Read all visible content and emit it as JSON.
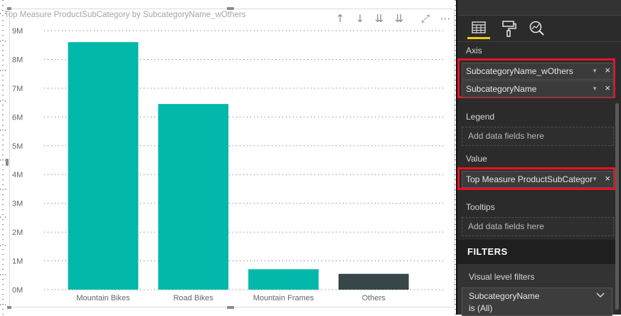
{
  "chart_data": {
    "type": "bar",
    "title": "Top Measure ProductSubCategory by SubcategoryName_wOthers",
    "categories": [
      "Mountain Bikes",
      "Road Bikes",
      "Mountain Frames",
      "Others"
    ],
    "values": [
      8600000,
      6450000,
      710000,
      550000
    ],
    "bar_colors": [
      "#01b8aa",
      "#01b8aa",
      "#01b8aa",
      "#374649"
    ],
    "yticks": [
      "0M",
      "1M",
      "2M",
      "3M",
      "4M",
      "5M",
      "6M",
      "7M",
      "8M",
      "9M"
    ],
    "ylim": [
      0,
      9000000
    ],
    "xlabel": "",
    "ylabel": "",
    "grid": true,
    "legend": "none"
  },
  "visual_controls": {
    "drill_up": "↑",
    "drill_down": "↓",
    "drill_all": "⇊",
    "expand": "⇊",
    "focus": "⤢",
    "more": "⋯"
  },
  "pane": {
    "tabs": [
      {
        "name": "fields",
        "icon": "fields-icon",
        "active": true
      },
      {
        "name": "format",
        "icon": "paint-roller-icon",
        "active": false
      },
      {
        "name": "analytics",
        "icon": "analytics-icon",
        "active": false
      }
    ],
    "axis": {
      "label": "Axis",
      "fields": [
        "SubcategoryName_wOthers",
        "SubcategoryName"
      ]
    },
    "legend": {
      "label": "Legend",
      "placeholder": "Add data fields here"
    },
    "value": {
      "label": "Value",
      "field": "Top Measure ProductSubCategor"
    },
    "tooltips": {
      "label": "Tooltips",
      "placeholder": "Add data fields here"
    },
    "filters": {
      "header": "FILTERS",
      "visual_level_label": "Visual level filters",
      "card_field": "SubcategoryName",
      "card_condition": "is (All)"
    },
    "colors": {
      "accent": "#f2c811",
      "highlight": "#e81123"
    }
  }
}
